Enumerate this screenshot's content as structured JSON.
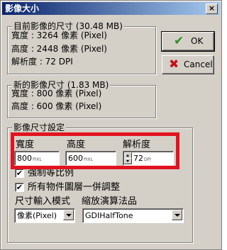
{
  "window": {
    "title": "影像大小",
    "close_glyph": "×"
  },
  "current_size": {
    "title": "目前影像的尺寸 (30.48 MB)",
    "width": "寬度 : 3264 像素 (Pixel)",
    "height": "高度 : 2448 像素 (Pixel)",
    "resolution": "解析度 : 72 DPI"
  },
  "new_size": {
    "title": "新的影像尺寸 (1.83 MB)",
    "width": "寬度 : 800 像素 (Pixel)",
    "height": "高度 : 600 像素 (Pixel)"
  },
  "buttons": {
    "ok_label": "OK",
    "ok_icon": "check-icon",
    "cancel_label": "Cancel",
    "cancel_icon": "x-icon"
  },
  "size_settings": {
    "title": "影像尺寸設定",
    "width_label": "寬度",
    "width_value": "800",
    "width_unit": "PIXL",
    "height_label": "高度",
    "height_value": "600",
    "height_unit": "PIXL",
    "resolution_label": "解析度",
    "resolution_value": "72",
    "resolution_unit": "DPI",
    "keep_ratio_label": "強制等比例",
    "keep_ratio_checked": true,
    "adjust_layers_label": "所有物件圖層一併調整",
    "adjust_layers_checked": true,
    "input_mode_label": "尺寸輸入模式",
    "input_mode_value": "像素(Pixel)",
    "resample_label": "縮放演算法品",
    "resample_value": "GDIHalfTone"
  },
  "colors": {
    "highlight_frame": "#e2131e",
    "ok_check": "#2e8b1f",
    "cancel_x": "#c0141c"
  }
}
